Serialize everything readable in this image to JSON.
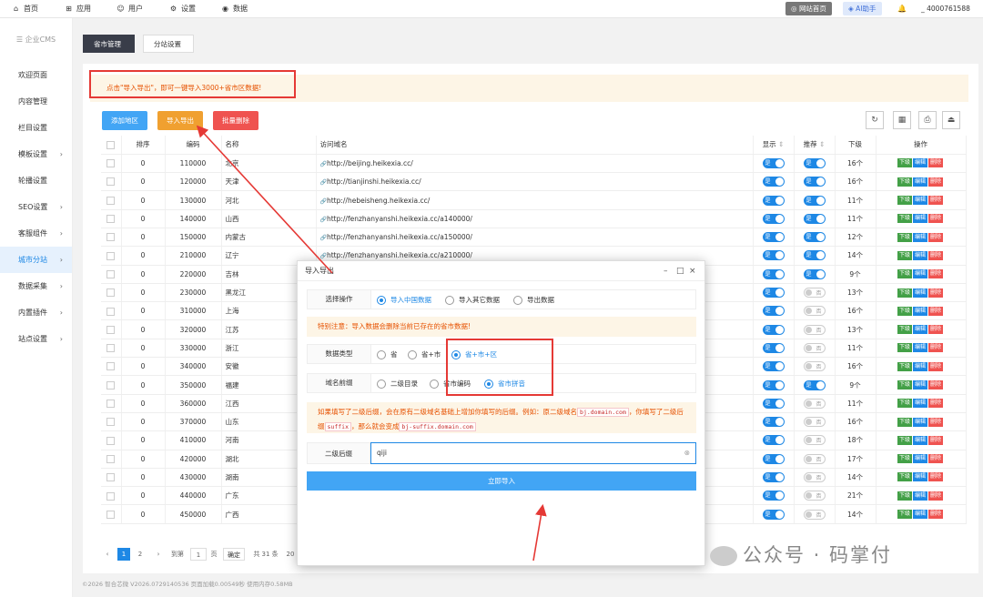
{
  "topnav": {
    "items": [
      {
        "icon": "home-icon",
        "label": "首页"
      },
      {
        "icon": "apps-icon",
        "label": "应用"
      },
      {
        "icon": "user-icon",
        "label": "用户"
      },
      {
        "icon": "gear-icon",
        "label": "设置"
      },
      {
        "icon": "database-icon",
        "label": "数据"
      }
    ],
    "site_home": "网站首页",
    "ai": "AI助手",
    "account": "4000761588"
  },
  "sidebar": {
    "title": "☰ 企业CMS",
    "items": [
      {
        "label": "欢迎页面",
        "arrow": false
      },
      {
        "label": "内容管理",
        "arrow": false
      },
      {
        "label": "栏目设置",
        "arrow": false
      },
      {
        "label": "模板设置",
        "arrow": true
      },
      {
        "label": "轮播设置",
        "arrow": false
      },
      {
        "label": "SEO设置",
        "arrow": true
      },
      {
        "label": "客服组件",
        "arrow": true
      },
      {
        "label": "城市分站",
        "arrow": true,
        "active": true
      },
      {
        "label": "数据采集",
        "arrow": true
      },
      {
        "label": "内置插件",
        "arrow": true
      },
      {
        "label": "站点设置",
        "arrow": true
      }
    ]
  },
  "tabs": [
    "省市管理",
    "分站设置"
  ],
  "notice": "点击\"导入导出\"，即可一键导入3000+省市区数据!",
  "toolbar": {
    "add": "添加地区",
    "import": "导入导出",
    "batch_delete": "批量删除"
  },
  "table": {
    "headers": [
      "",
      "排序",
      "编码",
      "名称",
      "访问域名",
      "显示",
      "推荐",
      "下级",
      "操作"
    ],
    "ops": [
      "下级",
      "编辑",
      "删除"
    ],
    "rows": [
      {
        "sort": "0",
        "code": "110000",
        "name": "北京",
        "domain": "http://beijing.heikexia.cc/",
        "show": true,
        "rec": true,
        "sub": "16个"
      },
      {
        "sort": "0",
        "code": "120000",
        "name": "天津",
        "domain": "http://tianjinshi.heikexia.cc/",
        "show": true,
        "rec": true,
        "sub": "16个"
      },
      {
        "sort": "0",
        "code": "130000",
        "name": "河北",
        "domain": "http://hebeisheng.heikexia.cc/",
        "show": true,
        "rec": true,
        "sub": "11个"
      },
      {
        "sort": "0",
        "code": "140000",
        "name": "山西",
        "domain": "http://fenzhanyanshi.heikexia.cc/a140000/",
        "show": true,
        "rec": true,
        "sub": "11个"
      },
      {
        "sort": "0",
        "code": "150000",
        "name": "内蒙古",
        "domain": "http://fenzhanyanshi.heikexia.cc/a150000/",
        "show": true,
        "rec": true,
        "sub": "12个"
      },
      {
        "sort": "0",
        "code": "210000",
        "name": "辽宁",
        "domain": "http://fenzhanyanshi.heikexia.cc/a210000/",
        "show": true,
        "rec": true,
        "sub": "14个"
      },
      {
        "sort": "0",
        "code": "220000",
        "name": "吉林",
        "domain": "",
        "show": true,
        "rec": true,
        "sub": "9个"
      },
      {
        "sort": "0",
        "code": "230000",
        "name": "黑龙江",
        "domain": "",
        "show": true,
        "rec": false,
        "sub": "13个"
      },
      {
        "sort": "0",
        "code": "310000",
        "name": "上海",
        "domain": "",
        "show": true,
        "rec": false,
        "sub": "16个"
      },
      {
        "sort": "0",
        "code": "320000",
        "name": "江苏",
        "domain": "",
        "show": true,
        "rec": false,
        "sub": "13个"
      },
      {
        "sort": "0",
        "code": "330000",
        "name": "浙江",
        "domain": "",
        "show": true,
        "rec": false,
        "sub": "11个"
      },
      {
        "sort": "0",
        "code": "340000",
        "name": "安徽",
        "domain": "",
        "show": true,
        "rec": false,
        "sub": "16个"
      },
      {
        "sort": "0",
        "code": "350000",
        "name": "福建",
        "domain": "",
        "show": true,
        "rec": true,
        "sub": "9个"
      },
      {
        "sort": "0",
        "code": "360000",
        "name": "江西",
        "domain": "",
        "show": true,
        "rec": false,
        "sub": "11个"
      },
      {
        "sort": "0",
        "code": "370000",
        "name": "山东",
        "domain": "",
        "show": true,
        "rec": false,
        "sub": "16个"
      },
      {
        "sort": "0",
        "code": "410000",
        "name": "河南",
        "domain": "",
        "show": true,
        "rec": false,
        "sub": "18个"
      },
      {
        "sort": "0",
        "code": "420000",
        "name": "湖北",
        "domain": "",
        "show": true,
        "rec": false,
        "sub": "17个"
      },
      {
        "sort": "0",
        "code": "430000",
        "name": "湖南",
        "domain": "",
        "show": true,
        "rec": false,
        "sub": "14个"
      },
      {
        "sort": "0",
        "code": "440000",
        "name": "广东",
        "domain": "",
        "show": true,
        "rec": false,
        "sub": "21个"
      },
      {
        "sort": "0",
        "code": "450000",
        "name": "广西",
        "domain": "",
        "show": true,
        "rec": false,
        "sub": "14个"
      }
    ]
  },
  "pager": {
    "pages": [
      "1",
      "2"
    ],
    "goto": "到第",
    "page_val": "1",
    "page_unit": "页",
    "confirm": "确定",
    "total": "共 31 条",
    "size": "20 条"
  },
  "footer": "©2026 智合芯微 V2026.0729140536 页面加载0.00549秒 使用内存0.58MB",
  "modal": {
    "title": "导入导出",
    "op_label": "选择操作",
    "op_options": [
      "导入中国数据",
      "导入其它数据",
      "导出数据"
    ],
    "warn1": "特别注意：导入数据会删除当前已存在的省市数据!",
    "type_label": "数据类型",
    "type_options": [
      "省",
      "省+市",
      "省+市+区"
    ],
    "prefix_label": "域名前缀",
    "prefix_options": [
      "二级目录",
      "省市编码",
      "省市拼音"
    ],
    "warn2_a": "如果填写了二级后缀，会在原有二级域名基础上增加你填写的后缀。例如：原二级域名",
    "warn2_code1": "bj.domain.com",
    "warn2_b": "，你填写了二级后缀",
    "warn2_code2": "suffix",
    "warn2_c": "，那么就会变成",
    "warn2_code3": "bj-suffix.domain.com",
    "suffix_label": "二级后缀",
    "suffix_value": "qiji",
    "submit": "立即导入"
  },
  "watermark": "公众号 · 码掌付"
}
